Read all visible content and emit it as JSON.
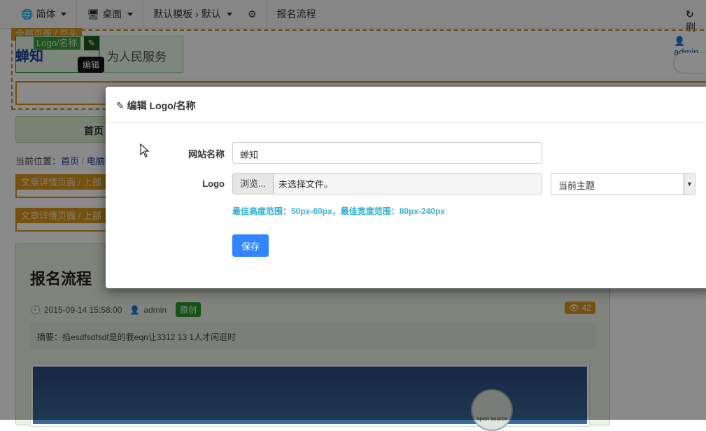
{
  "topbar": {
    "lang": "简体",
    "device": "桌面",
    "template": "默认模板",
    "theme": "默认",
    "page": "报名流程",
    "refresh": "刷"
  },
  "header": {
    "region_label": "全部页面 / 页头",
    "logo_name": "蝉知",
    "logo_tag": "Logo/名称",
    "edit_tooltip": "编辑",
    "slogan": "为人民服务",
    "user": "admin"
  },
  "nav": {
    "home": "首页"
  },
  "breadcrumb": {
    "prefix": "当前位置：",
    "home": "首页",
    "sep": "/",
    "next": "电脑"
  },
  "regions": [
    "文章详情页面 / 上部",
    "文章详情页面 / 上部"
  ],
  "article": {
    "title": "报名流程",
    "date": "2015-09-14 15:58:00",
    "author": "admin",
    "badge": "原创",
    "views": "42",
    "summary": "摘要：掐esdfsdfsdf是的我eqn让3312 13 1人才闲逛时",
    "image_text": "open source"
  },
  "modal": {
    "title": "编辑 Logo/名称",
    "name_label": "网站名称",
    "name_value": "蝉知",
    "logo_label": "Logo",
    "browse": "浏览...",
    "no_file": "未选择文件。",
    "theme_select": "当前主题",
    "hint": "最佳高度范围：50px-80px，最佳宽度范围：80px-240px",
    "save": "保存"
  },
  "colors": {
    "accent": "#3385ff",
    "hint": "#31b0d5",
    "region": "#d8961e",
    "green": "#3b9c3b"
  }
}
